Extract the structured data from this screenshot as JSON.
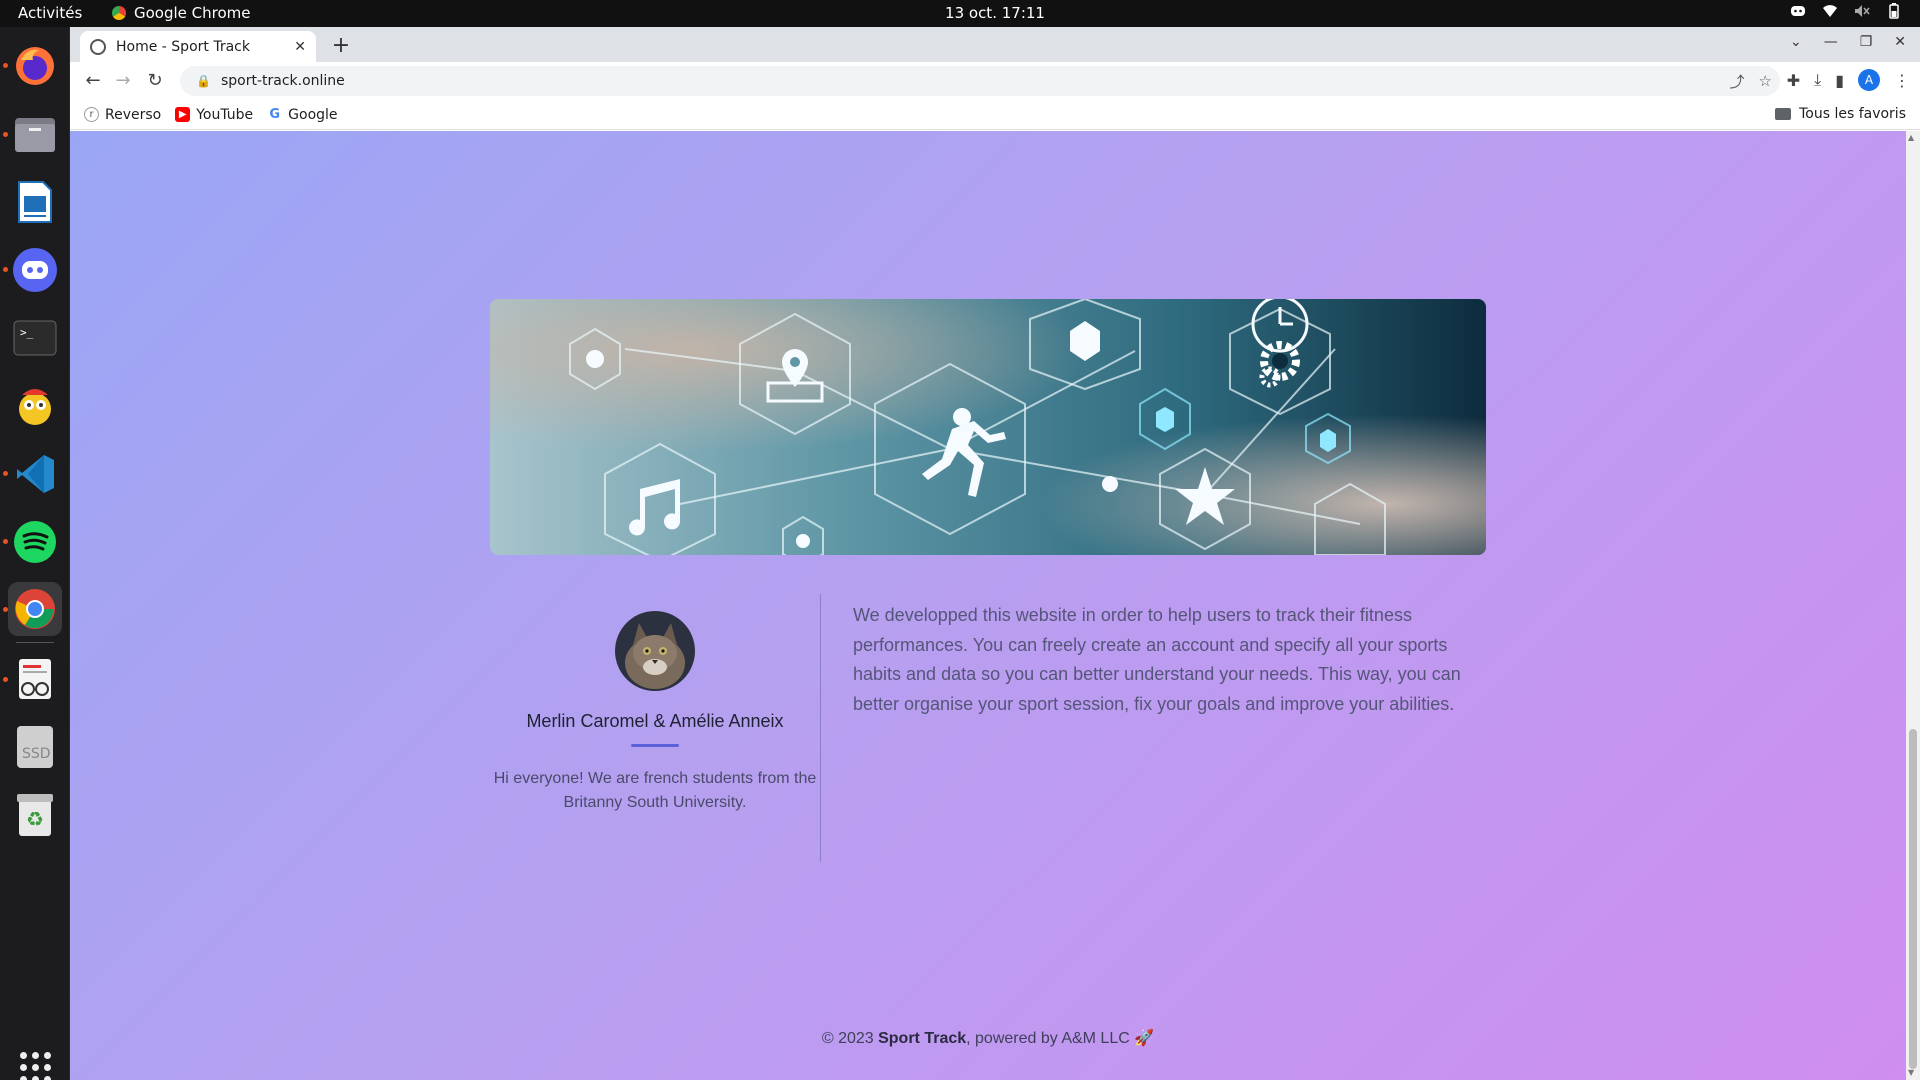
{
  "topbar": {
    "activities": "Activités",
    "app_name": "Google Chrome",
    "clock": "13 oct.  17:11",
    "tray_icons": [
      "discord-icon",
      "wifi-icon",
      "volume-icon",
      "battery-icon"
    ]
  },
  "dock": {
    "apps": [
      "Firefox",
      "Files",
      "LibreOffice Writer",
      "Discord",
      "Terminal",
      "Sticker app",
      "Visual Studio Code",
      "Spotify",
      "Google Chrome",
      "Reader",
      "SSD",
      "Trash"
    ],
    "ssd_label": "SSD"
  },
  "browser": {
    "tab_title": "Home - Sport Track",
    "url": "sport-track.online",
    "avatar_letter": "A",
    "bookmarks": [
      {
        "label": "Reverso",
        "color": "#e0e0e0"
      },
      {
        "label": "YouTube",
        "color": "#ff0000"
      },
      {
        "label": "Google",
        "color": "#4285f4"
      }
    ],
    "all_bookmarks": "Tous les favoris"
  },
  "page": {
    "author_names": "Merlin Caromel & Amélie Anneix",
    "author_bio": "Hi everyone! We are french students from the Britanny South University.",
    "about": "We developped this website in order to help users to track their fitness performances. You can freely create an account and specify all your sports habits and data so you can better understand your needs. This way, you can better organise your sport session, fix your goals and improve your abilities.",
    "footer_prefix": "© 2023 ",
    "footer_brand": "Sport Track",
    "footer_suffix": ", powered by A&M LLC 🚀",
    "accent_color": "#5b5fd8"
  }
}
